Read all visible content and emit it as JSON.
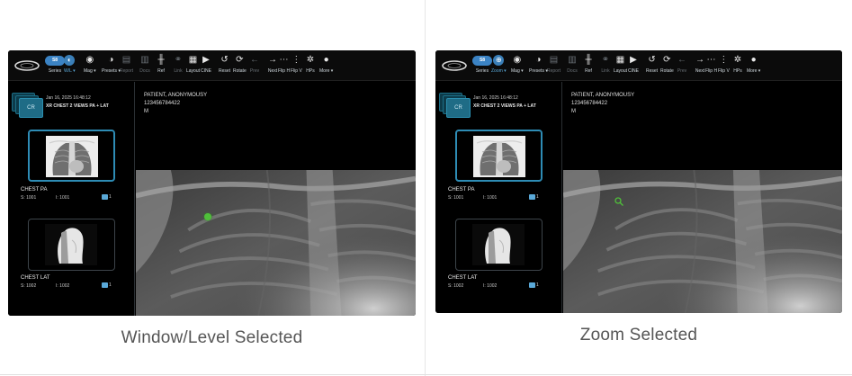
{
  "toolbar": {
    "items": [
      {
        "icon": "series-pill",
        "label": "Series"
      },
      {
        "icon": "window-level-icon",
        "label": "W/L ▾"
      },
      {
        "icon": "zoom-icon",
        "label": "Zoom ▾"
      },
      {
        "icon": "magnify-icon",
        "label": "Mag ▾"
      },
      {
        "icon": "presets-icon",
        "label": "Presets ▾"
      },
      {
        "icon": "report-icon",
        "label": "Report"
      },
      {
        "icon": "docs-icon",
        "label": "Docs"
      },
      {
        "icon": "ref-icon",
        "label": "Ref"
      },
      {
        "icon": "link-icon",
        "label": "Link"
      },
      {
        "icon": "layout-icon",
        "label": "Layout"
      },
      {
        "icon": "cine-icon",
        "label": "CINE"
      },
      {
        "icon": "reset-icon",
        "label": "Reset"
      },
      {
        "icon": "rotate-icon",
        "label": "Rotate"
      },
      {
        "icon": "prev-icon",
        "label": "Prev"
      },
      {
        "icon": "next-icon",
        "label": "Next"
      },
      {
        "icon": "flip-h-icon",
        "label": "Flip H"
      },
      {
        "icon": "flip-v-icon",
        "label": "Flip V"
      },
      {
        "icon": "hps-icon",
        "label": "HPs"
      },
      {
        "icon": "more-icon",
        "label": "More ▾"
      }
    ],
    "series_pill_text": "S8"
  },
  "study": {
    "modality": "CR",
    "date": "Jan 16, 2025 16:48:12",
    "description": "XR CHEST 2 VIEWS PA + LAT"
  },
  "thumbnails": [
    {
      "name": "CHEST PA",
      "series": "S: 1001",
      "instance": "I: 1001",
      "count": "1"
    },
    {
      "name": "CHEST LAT",
      "series": "S: 1002",
      "instance": "I: 1002",
      "count": "1"
    }
  ],
  "patient": {
    "name": "PATIENT, ANONYMOUSY",
    "id": "123456784422",
    "sex": "M"
  },
  "panels": [
    {
      "caption": "Window/Level Selected",
      "active_tool": "W/L ▾"
    },
    {
      "caption": "Zoom Selected",
      "active_tool": "Zoom ▾"
    }
  ],
  "colors": {
    "accent": "#3b83c4",
    "thumb_border": "#2e8cb5",
    "cursor_green": "#4fbf3a"
  }
}
